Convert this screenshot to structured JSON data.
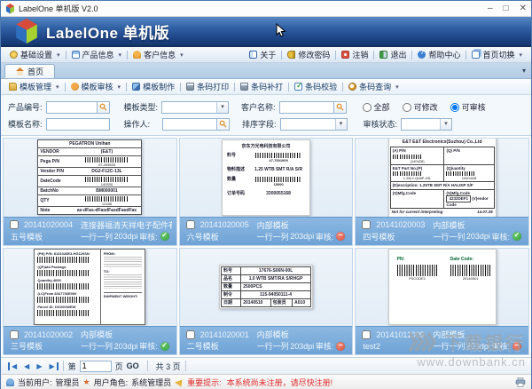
{
  "window": {
    "title": "LabelOne 单机版 V2.0"
  },
  "header": {
    "brand": "LabelOne 单机版"
  },
  "menubar": {
    "left": [
      {
        "label": "基础设置"
      },
      {
        "label": "产品信息"
      },
      {
        "label": "客户信息"
      }
    ],
    "right": [
      {
        "label": "关于"
      },
      {
        "label": "修改密码"
      },
      {
        "label": "注销"
      },
      {
        "label": "退出"
      },
      {
        "label": "帮助中心"
      },
      {
        "label": "首页切换"
      }
    ]
  },
  "tabs": {
    "home": "首页"
  },
  "toolbar": {
    "items": [
      {
        "label": "模板管理"
      },
      {
        "label": "模板审核"
      },
      {
        "label": "模板制作"
      },
      {
        "label": "条码打印"
      },
      {
        "label": "条码补打"
      },
      {
        "label": "条码校验"
      },
      {
        "label": "条码查询"
      }
    ]
  },
  "filters": {
    "product_no_label": "产品编号:",
    "template_type_label": "模板类型:",
    "customer_name_label": "客户名称:",
    "template_name_label": "模板名称:",
    "operator_label": "操作人:",
    "sort_field_label": "排序字段:",
    "audit_status_label": "审核状态:",
    "product_no_value": "",
    "template_type_value": "",
    "customer_name_value": "",
    "template_name_value": "",
    "operator_value": "",
    "sort_field_value": "",
    "audit_status_value": "",
    "scope": {
      "options": [
        "全部",
        "可修改",
        "可审核"
      ],
      "selected": "可审核"
    }
  },
  "cards": [
    {
      "id": "20141020004",
      "info": "连接器福清天祥电子配件有...",
      "name": "五号模板",
      "layout": "一行一列",
      "dpi": "203dpi",
      "audit_label": "审核:",
      "approved": true,
      "preview": {
        "title": "PEGATRON Unihan",
        "vendor_label": "VENDOR",
        "vendor_value": "(E&T)",
        "rows": [
          {
            "label": "Pega P/N",
            "sub": "47-409828"
          },
          {
            "label": "Vendor P/N",
            "value": "DG2-F12C-13L"
          },
          {
            "label": "DateCode",
            "sub": "140530"
          },
          {
            "label": "BatchNo",
            "value": "BM000001"
          },
          {
            "label": "QTY",
            "sub": "12458"
          },
          {
            "label": "Note",
            "value": "as-dFas-dFasdFasdFasdFas"
          }
        ]
      }
    },
    {
      "id": "20141020005",
      "info": "内部模板",
      "name": "六号模板",
      "layout": "一行一列",
      "dpi": "203dpi",
      "audit_label": "审核:",
      "approved": false,
      "preview": {
        "title": "京东方光电科技有限公司",
        "rows": [
          {
            "label": "料号",
            "sub": "47-7501009"
          },
          {
            "label": "物料描述",
            "value": "1.25 WTB SMT R/A S/R"
          },
          {
            "label": "数量",
            "sub": "15000"
          },
          {
            "label": "订单号码",
            "value": "3300055168"
          }
        ]
      }
    },
    {
      "id": "20141020003",
      "info": "内部模板",
      "name": "四号模板",
      "layout": "一行一列",
      "dpi": "203dpi",
      "audit_label": "审核:",
      "approved": true,
      "preview": {
        "title": "E&T E&T Electronics(Suzhou) Co.,Ltd",
        "c1": "(A) P/N",
        "c1sub": "(140428)",
        "c2": "(Q) P/N",
        "c3": "E&T Part No.(P)",
        "c3sub": "1.25LY-Q08P-03L",
        "c4": "(Q)uantity",
        "c4sub": "10004/28",
        "desc_label": "(D)escription:",
        "desc": "1.25TB SMT R/A HALDIP S/F",
        "m1": "(S)Mfg.Code",
        "m2": "(S)Mfg.Code",
        "m2v": "4232DEF1",
        "m3": "(V)endor Code",
        "foot": "Not for current interpreting",
        "date": "14.07.28"
      }
    },
    {
      "id": "20141020002",
      "info": "内部模板",
      "name": "三号模板",
      "layout": "一行一列",
      "dpi": "203dpi",
      "audit_label": "审核:",
      "approved": true,
      "preview": {
        "rows": [
          {
            "label": "(PN) P/N: 8131028E3-HG120SN"
          },
          {
            "label": "(QP)atd Package:"
          },
          {
            "label": "Quantity-4000"
          },
          {
            "label": "(LC)From 8347736E000"
          },
          {
            "label": "Parcel ID: DG20000EW"
          }
        ],
        "from_label": "FROM:",
        "to_label": "TO:",
        "weight_label": "SHIPMENT WEIGHT:"
      }
    },
    {
      "id": "20141020001",
      "info": "内部模板",
      "name": "二号模板",
      "layout": "一行一列",
      "dpi": "203dpi",
      "audit_label": "审核:",
      "approved": false,
      "preview": {
        "rows": [
          {
            "label": "料号",
            "value": "17676-S06N-00L"
          },
          {
            "label": "品名",
            "value": "1.0 WTB SMT/RA S/RHGP"
          },
          {
            "label": "数量",
            "value": "2500PCS"
          },
          {
            "label": "制令",
            "value": "115-94050111-4"
          }
        ],
        "last": {
          "label": "日期",
          "v1": "20140510",
          "v2": "包装员",
          "v3": "A010"
        }
      }
    },
    {
      "id": "20141011009",
      "info": "内部模板",
      "name": "test2",
      "layout": "一行一列",
      "dpi": "203dpi",
      "audit_label": "审核:",
      "approved": false,
      "preview": {
        "pn_label": "PN:",
        "pn_sub": "P0CODE1",
        "dc_label": "Date Code:",
        "dc_sub": "20140501"
      }
    }
  ],
  "pagination": {
    "page_prefix": "第",
    "page_value": "1",
    "page_suffix": "页",
    "go": "GO",
    "total": "共 3 页"
  },
  "statusbar": {
    "user_label": "当前用户:",
    "user": "管理员",
    "role_label": "用户角色:",
    "role": "系统管理员",
    "alert_label": "重要提示:",
    "alert": "本系统尚未注册，请尽快注册!"
  },
  "watermark": {
    "brand": "下载银行",
    "url": "www.downbank.cn"
  }
}
